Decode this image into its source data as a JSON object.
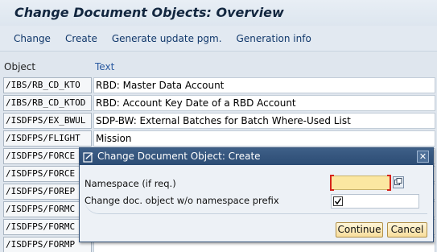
{
  "window": {
    "title": "Change Document Objects: Overview"
  },
  "toolbar": {
    "change": "Change",
    "create": "Create",
    "generate_update": "Generate update pgm.",
    "generation_info": "Generation info"
  },
  "table": {
    "columns": {
      "object": "Object",
      "text": "Text"
    },
    "rows": [
      {
        "object": "/IBS/RB_CD_KTO",
        "text": "RBD: Master Data Account"
      },
      {
        "object": "/IBS/RB_CD_KTOD",
        "text": "RBD: Account Key Date of a RBD Account"
      },
      {
        "object": "/ISDFPS/EX_BWUL",
        "text": "SDP-BW: External Batches for Batch Where-Used List"
      },
      {
        "object": "/ISDFPS/FLIGHT",
        "text": "Mission"
      },
      {
        "object": "/ISDFPS/FORCE",
        "text": ""
      },
      {
        "object": "/ISDFPS/FORCE",
        "text": ""
      },
      {
        "object": "/ISDFPS/FOREP",
        "text": ""
      },
      {
        "object": "/ISDFPS/FORMC",
        "text": ""
      },
      {
        "object": "/ISDFPS/FORMC",
        "text": ""
      },
      {
        "object": "/ISDFPS/FORMP",
        "text": ""
      }
    ]
  },
  "dialog": {
    "title": "Change Document Object: Create",
    "namespace_label": "Namespace (if req.)",
    "namespace_value": "",
    "without_prefix_label": "Change doc. object w/o namespace prefix",
    "without_prefix_checked": true,
    "continue_label": "Continue",
    "cancel_label": "Cancel",
    "close_glyph": "✕"
  },
  "colors": {
    "dialog_title_bg": "#2f4f78",
    "required_field_bg": "#fbe7a1",
    "required_marker": "#d6231c",
    "button_bg": "#f8de9c"
  }
}
